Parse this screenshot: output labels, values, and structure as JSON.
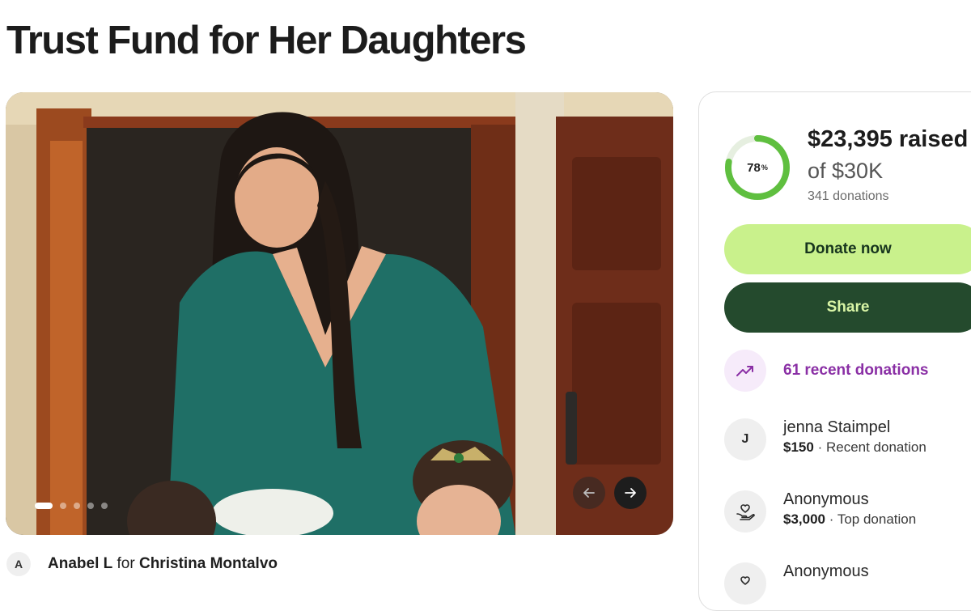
{
  "page": {
    "title": "Trust Fund for Her Daughters"
  },
  "gallery": {
    "slide_count": 5,
    "active_slide": 1
  },
  "organizer": {
    "avatar_initial": "A",
    "name": "Anabel L",
    "connector": "for",
    "beneficiary": "Christina Montalvo"
  },
  "progress": {
    "percent": 78,
    "percent_label": "78",
    "percent_sign": "%",
    "raised_text": "$23,395 raised",
    "goal_text": "of $30K",
    "donations_text": "341 donations"
  },
  "actions": {
    "donate_label": "Donate now",
    "share_label": "Share"
  },
  "recent": {
    "label": "61 recent donations"
  },
  "donations": [
    {
      "initial": "J",
      "name": "jenna Staimpel",
      "amount": "$150",
      "separator": "·",
      "note": "Recent donation",
      "icon": "initial"
    },
    {
      "initial": "",
      "name": "Anonymous",
      "amount": "$3,000",
      "separator": "·",
      "note": "Top donation",
      "icon": "heart-hand-icon"
    },
    {
      "initial": "",
      "name": "Anonymous",
      "amount": "",
      "separator": "",
      "note": "",
      "icon": "heart-hand-icon"
    }
  ],
  "colors": {
    "ring": "#5fbf3f",
    "ring_track": "#e6efe0",
    "donate_bg": "#c9f18c",
    "share_bg": "#244a2d",
    "recent_accent": "#8a2fa5"
  }
}
